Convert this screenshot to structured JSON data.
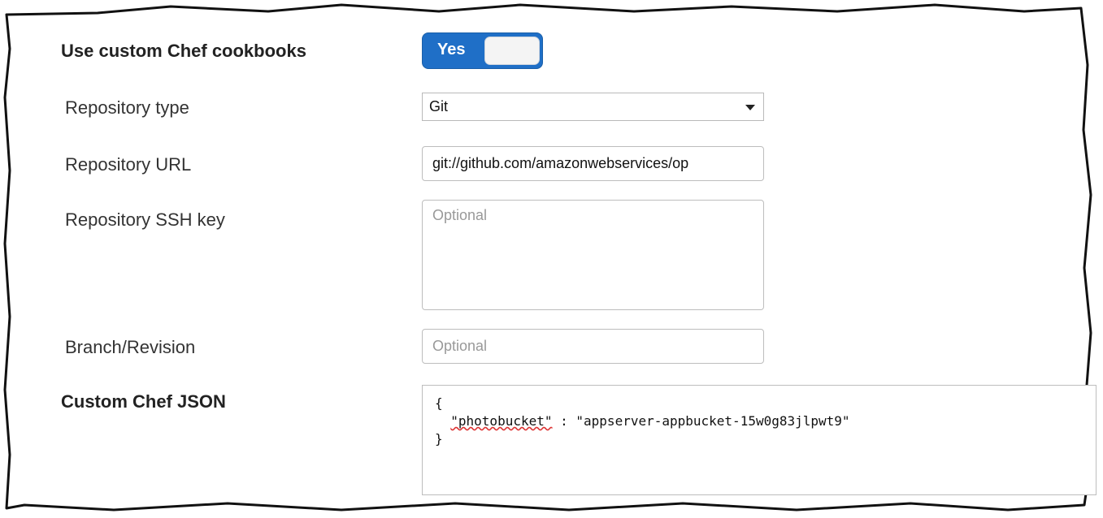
{
  "custom_cookbooks": {
    "label": "Use custom Chef cookbooks",
    "toggle_label": "Yes"
  },
  "repository_type": {
    "label": "Repository type",
    "value": "Git"
  },
  "repository_url": {
    "label": "Repository URL",
    "value": "git://github.com/amazonwebservices/op"
  },
  "repository_ssh_key": {
    "label": "Repository SSH key",
    "placeholder": "Optional"
  },
  "branch_revision": {
    "label": "Branch/Revision",
    "placeholder": "Optional"
  },
  "custom_json": {
    "label": "Custom Chef JSON",
    "line1": "{",
    "line2_indent": "  ",
    "line2_key": "\"photobucket\"",
    "line2_rest": " : \"appserver-appbucket-15w0g83jlpwt9\"",
    "line3": "}"
  },
  "colors": {
    "toggle_on": "#1f6fc7",
    "spellcheck": "#d33"
  }
}
